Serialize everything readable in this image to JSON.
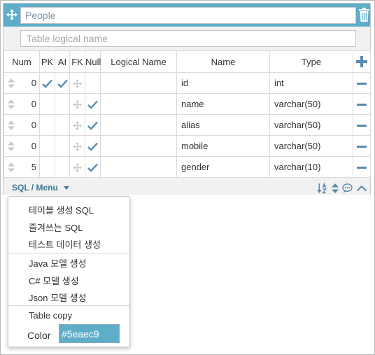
{
  "table": {
    "name": "People",
    "logical_name_placeholder": "Table logical name",
    "logical_name": ""
  },
  "columns_header": {
    "num": "Num",
    "pk": "PK",
    "ai": "AI",
    "fk": "FK",
    "null": "Null",
    "logical_name": "Logical Name",
    "name": "Name",
    "type": "Type"
  },
  "rows": [
    {
      "num": "0",
      "pk": true,
      "ai": true,
      "null": false,
      "logical_name": "",
      "name": "id",
      "type": "int"
    },
    {
      "num": "0",
      "pk": false,
      "ai": false,
      "null": true,
      "logical_name": "",
      "name": "name",
      "type": "varchar(50)"
    },
    {
      "num": "0",
      "pk": false,
      "ai": false,
      "null": true,
      "logical_name": "",
      "name": "alias",
      "type": "varchar(50)"
    },
    {
      "num": "0",
      "pk": false,
      "ai": false,
      "null": true,
      "logical_name": "",
      "name": "mobile",
      "type": "varchar(50)"
    },
    {
      "num": "5",
      "pk": false,
      "ai": false,
      "null": true,
      "logical_name": "",
      "name": "gender",
      "type": "varchar(10)"
    }
  ],
  "footer": {
    "sql_menu_label": "SQL / Menu"
  },
  "menu": {
    "create_table_sql": "테이블 생성 SQL",
    "favorite_sql": "즐겨쓰는 SQL",
    "test_data": "테스트 데이터 생성",
    "java_model": "Java 모델 생성",
    "csharp_model": "C# 모델 생성",
    "json_model": "Json 모델 생성",
    "table_copy": "Table copy",
    "color_label": "Color",
    "color_value": "#5eaec9"
  },
  "colors": {
    "accent": "#5eaec9",
    "icon": "#5a8aab",
    "check": "#5f93b2"
  },
  "icons": [
    "move-icon",
    "trash-icon",
    "add-column-icon",
    "remove-column-icon",
    "sort-handle-icon",
    "fk-icon",
    "check-icon",
    "sort-az-icon",
    "reorder-icon",
    "comment-icon",
    "collapse-icon",
    "caret-down-icon"
  ]
}
